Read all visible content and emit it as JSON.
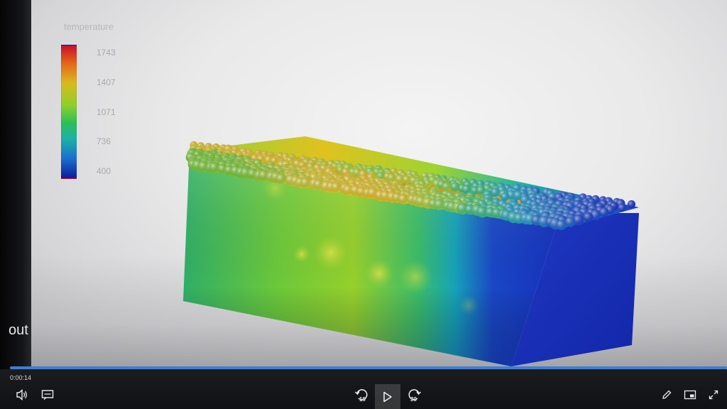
{
  "legend": {
    "title": "temperature",
    "ticks": [
      "1743",
      "1407",
      "1071",
      "736",
      "400"
    ]
  },
  "overlay": {
    "side_text": "out"
  },
  "player": {
    "time": "0:00:14",
    "progress": 1.0,
    "skip_back": "10",
    "skip_forward": "30",
    "accent_color": "#3d7fd1",
    "icons": [
      "volume-icon",
      "captions-icon",
      "skip-back-10-icon",
      "play-icon",
      "skip-forward-30-icon",
      "pen-icon",
      "miniplayer-icon",
      "fullscreen-icon"
    ]
  }
}
